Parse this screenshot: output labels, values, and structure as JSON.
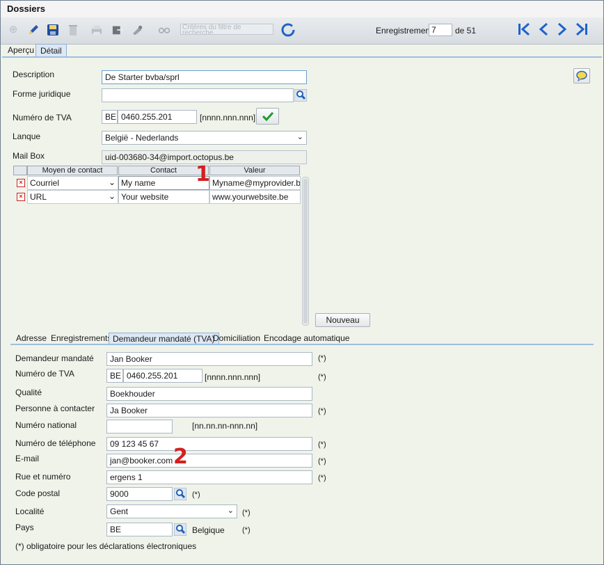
{
  "window": {
    "title": "Dossiers"
  },
  "toolbar": {
    "filter_placeholder": "Critères du filtre de recherche",
    "record_label": "Enregistrement",
    "record_value": "7",
    "record_of": "de 51"
  },
  "top_tabs": [
    "Aperçu",
    "Détail"
  ],
  "form": {
    "description_label": "Description",
    "description_value": "De Starter bvba/sprl",
    "forme_label": "Forme juridique",
    "forme_value": "",
    "tva_label": "Numéro de TVA",
    "tva_country": "BE",
    "tva_value": "0460.255.201",
    "tva_format": "[nnnn.nnn.nnn]",
    "langue_label": "Lanque",
    "langue_value": "België - Nederlands",
    "mailbox_label": "Mail Box",
    "mailbox_value": "uid-003680-34@import.octopus.be"
  },
  "contact_grid": {
    "headers": [
      "Moyen de contact",
      "Contact",
      "Valeur"
    ],
    "rows": [
      {
        "type": "Courriel",
        "contact": "My name",
        "value": "Myname@myprovider.be"
      },
      {
        "type": "URL",
        "contact": "Your website",
        "value": "www.yourwebsite.be"
      }
    ],
    "new_button": "Nouveau"
  },
  "bottom_tabs": [
    "Adresse",
    "Enregistrements",
    "Demandeur mandaté (TVA)",
    "Domiciliation",
    "Encodage automatique"
  ],
  "mandate": {
    "demandeur_label": "Demandeur mandaté",
    "demandeur_value": "Jan Booker",
    "tva_label": "Numéro de TVA",
    "tva_country": "BE",
    "tva_value": "0460.255.201",
    "tva_format": "[nnnn.nnn.nnn]",
    "qualite_label": "Qualité",
    "qualite_value": "Boekhouder",
    "personne_label": "Personne à contacter",
    "personne_value": "Ja Booker",
    "national_label": "Numéro national",
    "national_value": "",
    "national_format": "[nn.nn.nn-nnn.nn]",
    "tel_label": "Numéro de téléphone",
    "tel_value": "09 123 45 67",
    "email_label": "E-mail",
    "email_value": "jan@booker.com",
    "rue_label": "Rue et numéro",
    "rue_value": "ergens 1",
    "cp_label": "Code postal",
    "cp_value": "9000",
    "localite_label": "Localité",
    "localite_value": "Gent",
    "pays_label": "Pays",
    "pays_value": "BE",
    "pays_name": "Belgique",
    "required_mark": "(*)",
    "footnote": "(*) obligatoire pour les déclarations électroniques"
  },
  "annotations": {
    "one": "1",
    "two": "2"
  }
}
